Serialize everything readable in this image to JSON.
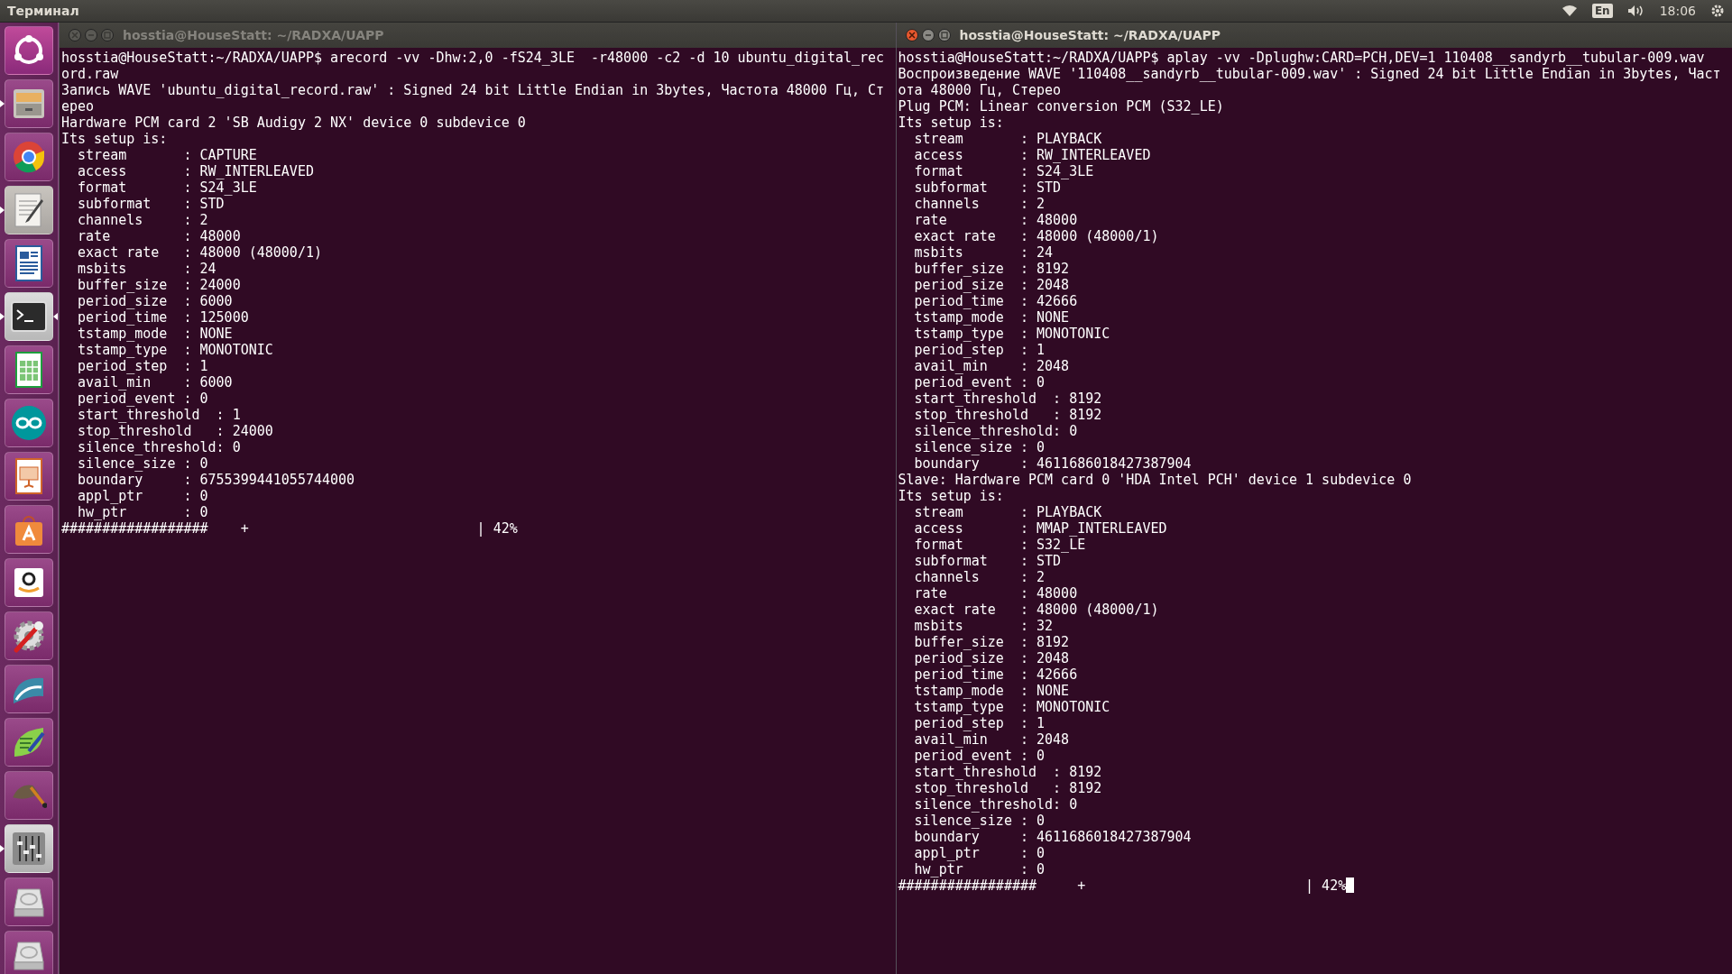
{
  "top_bar": {
    "app_title": "Терминал",
    "keyboard_layout": "En",
    "clock": "18:06"
  },
  "launcher": [
    {
      "kind": "ubuntu",
      "running": false,
      "focused": false
    },
    {
      "kind": "files",
      "running": true,
      "focused": false
    },
    {
      "kind": "chrome",
      "running": false,
      "focused": false
    },
    {
      "kind": "text-editor",
      "running": true,
      "focused": false
    },
    {
      "kind": "writer",
      "running": false,
      "focused": false
    },
    {
      "kind": "terminal",
      "running": true,
      "focused": true
    },
    {
      "kind": "calc",
      "running": false,
      "focused": false
    },
    {
      "kind": "arduino",
      "running": false,
      "focused": false
    },
    {
      "kind": "impress",
      "running": false,
      "focused": false
    },
    {
      "kind": "software",
      "running": false,
      "focused": false
    },
    {
      "kind": "amazon",
      "running": false,
      "focused": false
    },
    {
      "kind": "settings",
      "running": false,
      "focused": false
    },
    {
      "kind": "wave",
      "running": false,
      "focused": false
    },
    {
      "kind": "leaf",
      "running": false,
      "focused": false
    },
    {
      "kind": "brush",
      "running": false,
      "focused": false
    },
    {
      "kind": "mixer",
      "running": true,
      "focused": false
    },
    {
      "kind": "disk",
      "running": false,
      "focused": false
    },
    {
      "kind": "disk",
      "running": false,
      "focused": false
    }
  ],
  "terminals": [
    {
      "title": "hosstia@HouseStatt: ~/RADXA/UAPP",
      "active": false,
      "cursor": false,
      "lines": [
        "hosstia@HouseStatt:~/RADXA/UAPP$ arecord -vv -Dhw:2,0 -fS24_3LE  -r48000 -c2 -d 10 ubuntu_digital_rec",
        "ord.raw",
        "Запись WAVE 'ubuntu_digital_record.raw' : Signed 24 bit Little Endian in 3bytes, Частота 48000 Гц, Ст",
        "ерео",
        "Hardware PCM card 2 'SB Audigy 2 NX' device 0 subdevice 0",
        "Its setup is:",
        "  stream       : CAPTURE",
        "  access       : RW_INTERLEAVED",
        "  format       : S24_3LE",
        "  subformat    : STD",
        "  channels     : 2",
        "  rate         : 48000",
        "  exact rate   : 48000 (48000/1)",
        "  msbits       : 24",
        "  buffer_size  : 24000",
        "  period_size  : 6000",
        "  period_time  : 125000",
        "  tstamp_mode  : NONE",
        "  tstamp_type  : MONOTONIC",
        "  period_step  : 1",
        "  avail_min    : 6000",
        "  period_event : 0",
        "  start_threshold  : 1",
        "  stop_threshold   : 24000",
        "  silence_threshold: 0",
        "  silence_size : 0",
        "  boundary     : 6755399441055744000",
        "  appl_ptr     : 0",
        "  hw_ptr       : 0",
        "##################    +                            | 42%"
      ]
    },
    {
      "title": "hosstia@HouseStatt: ~/RADXA/UAPP",
      "active": true,
      "cursor": true,
      "lines": [
        "hosstia@HouseStatt:~/RADXA/UAPP$ aplay -vv -Dplughw:CARD=PCH,DEV=1 110408__sandyrb__tubular-009.wav",
        "Воспроизведение WAVE '110408__sandyrb__tubular-009.wav' : Signed 24 bit Little Endian in 3bytes, Част",
        "ота 48000 Гц, Стерео",
        "Plug PCM: Linear conversion PCM (S32_LE)",
        "Its setup is:",
        "  stream       : PLAYBACK",
        "  access       : RW_INTERLEAVED",
        "  format       : S24_3LE",
        "  subformat    : STD",
        "  channels     : 2",
        "  rate         : 48000",
        "  exact rate   : 48000 (48000/1)",
        "  msbits       : 24",
        "  buffer_size  : 8192",
        "  period_size  : 2048",
        "  period_time  : 42666",
        "  tstamp_mode  : NONE",
        "  tstamp_type  : MONOTONIC",
        "  period_step  : 1",
        "  avail_min    : 2048",
        "  period_event : 0",
        "  start_threshold  : 8192",
        "  stop_threshold   : 8192",
        "  silence_threshold: 0",
        "  silence_size : 0",
        "  boundary     : 4611686018427387904",
        "Slave: Hardware PCM card 0 'HDA Intel PCH' device 1 subdevice 0",
        "Its setup is:",
        "  stream       : PLAYBACK",
        "  access       : MMAP_INTERLEAVED",
        "  format       : S32_LE",
        "  subformat    : STD",
        "  channels     : 2",
        "  rate         : 48000",
        "  exact rate   : 48000 (48000/1)",
        "  msbits       : 32",
        "  buffer_size  : 8192",
        "  period_size  : 2048",
        "  period_time  : 42666",
        "  tstamp_mode  : NONE",
        "  tstamp_type  : MONOTONIC",
        "  period_step  : 1",
        "  avail_min    : 2048",
        "  period_event : 0",
        "  start_threshold  : 8192",
        "  stop_threshold   : 8192",
        "  silence_threshold: 0",
        "  silence_size : 0",
        "  boundary     : 4611686018427387904",
        "  appl_ptr     : 0",
        "  hw_ptr       : 0",
        "#################     +                           | 42%"
      ]
    }
  ]
}
